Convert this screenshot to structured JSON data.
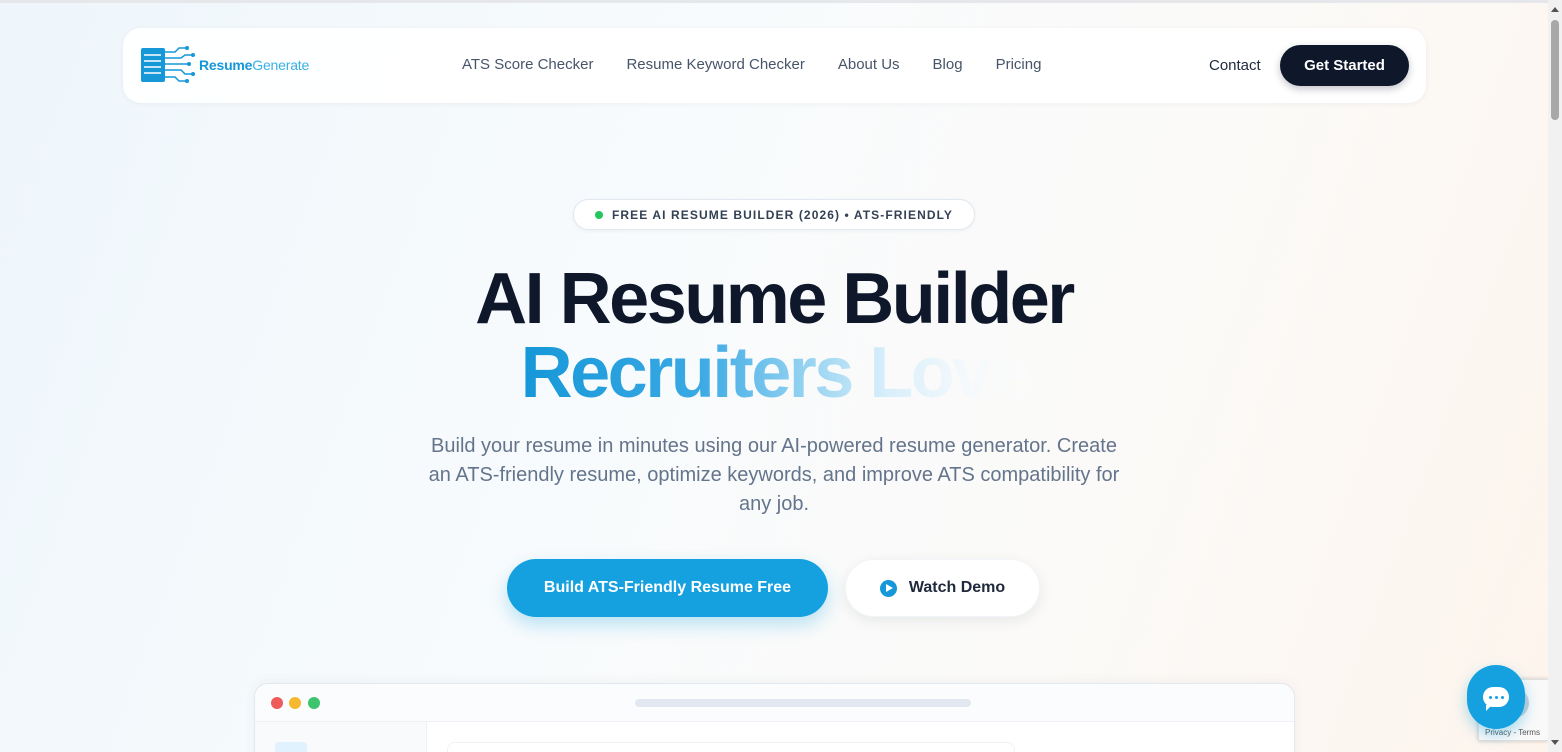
{
  "header": {
    "logo": {
      "text_primary": "Resume",
      "text_secondary": "Generate",
      "icon": "circuit-document-icon"
    },
    "nav_links": [
      {
        "label": "ATS Score Checker"
      },
      {
        "label": "Resume Keyword Checker"
      },
      {
        "label": "About Us"
      },
      {
        "label": "Blog"
      },
      {
        "label": "Pricing"
      }
    ],
    "contact_label": "Contact",
    "cta_label": "Get Started"
  },
  "hero": {
    "badge": "FREE AI RESUME BUILDER (2026) • ATS-FRIENDLY",
    "title_line1": "AI Resume Builder",
    "title_line2": "Recruiters Love",
    "subtitle": "Build your resume in minutes using our AI-powered resume generator. Create an ATS-friendly resume, optimize keywords, and improve ATS compatibility for any job.",
    "primary_cta": "Build ATS-Friendly Resume Free",
    "secondary_cta": "Watch Demo"
  },
  "widgets": {
    "recaptcha_text": "Privacy - Terms",
    "chat_icon": "chat-bubble-icon"
  },
  "colors": {
    "brand": "#15a0e0",
    "dark": "#0f172a",
    "badge_dot": "#22c55e"
  }
}
